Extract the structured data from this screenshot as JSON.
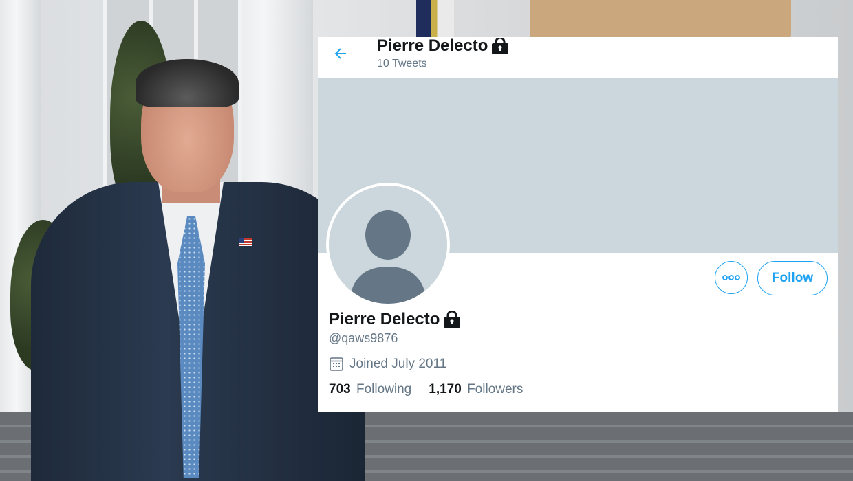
{
  "profile_header": {
    "back_icon": "arrow-left-icon",
    "display_name": "Pierre Delecto",
    "tweet_count": "10 Tweets",
    "protected_icon": "lock-icon"
  },
  "profile": {
    "display_name": "Pierre Delecto",
    "handle": "@qaws9876",
    "joined_icon": "calendar-icon",
    "joined": "Joined July 2011",
    "following_count": "703",
    "following_label": "Following",
    "followers_count": "1,170",
    "followers_label": "Followers",
    "avatar": "default-avatar-icon"
  },
  "actions": {
    "more_icon": "more-dots-icon",
    "follow_label": "Follow"
  },
  "colors": {
    "accent": "#1da1f2",
    "banner": "#ccd6dd",
    "text_primary": "#14171a",
    "text_secondary": "#657786"
  }
}
